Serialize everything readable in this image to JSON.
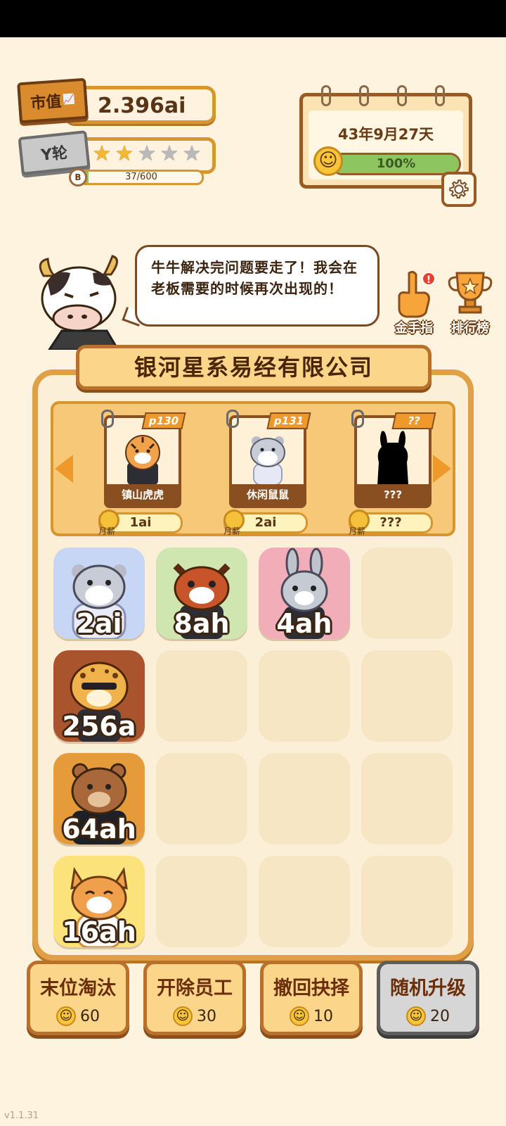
{
  "header": {
    "market_value_label": "市值",
    "market_value": "2.396ai",
    "round_label": "Y轮",
    "stars_filled": 2,
    "stars_total": 5,
    "xp_badge": "B",
    "xp_text": "37/600",
    "xp_current": 37,
    "xp_max": 600
  },
  "calendar": {
    "date": "43年9月27天",
    "mood_text": "100%",
    "mood_percent": 100
  },
  "dialog": {
    "text": "牛牛解决完问题要走了！我会在老板需要的时候再次出现的！"
  },
  "side_buttons": {
    "golden_finger": "金手指",
    "golden_finger_badge": "!",
    "leaderboard": "排行榜"
  },
  "company": {
    "name": "银河星系易经有限公司"
  },
  "candidates": [
    {
      "tag": "p130",
      "name": "镇山虎虎",
      "wage": "1ai",
      "wage_label": "月薪"
    },
    {
      "tag": "p131",
      "name": "休闲鼠鼠",
      "wage": "2ai",
      "wage_label": "月薪"
    },
    {
      "tag": "??",
      "name": "???",
      "wage": "???",
      "wage_label": "月薪"
    }
  ],
  "grid": [
    {
      "animal": "hamster",
      "value": "2ai",
      "bg": "#c8d6f6"
    },
    {
      "animal": "red-panda",
      "value": "8ah",
      "bg": "#cfe6b0"
    },
    {
      "animal": "bunny",
      "value": "4ah",
      "bg": "#f2aeb8"
    },
    {
      "animal": "leopard",
      "value": "256a",
      "bg": "#a9542c"
    },
    {
      "animal": "bear",
      "value": "64ah",
      "bg": "#e59b3a"
    },
    {
      "animal": "cat",
      "value": "16ah",
      "bg": "#fbe27a"
    }
  ],
  "actions": [
    {
      "label": "末位淘汰",
      "cost": "60"
    },
    {
      "label": "开除员工",
      "cost": "30"
    },
    {
      "label": "撤回抉择",
      "cost": "10"
    },
    {
      "label": "随机升级",
      "cost": "20"
    }
  ],
  "version": "v1.1.31",
  "colors": {
    "background": "#fdf3de",
    "accent_orange": "#e0a047",
    "progress_green": "#8dc561",
    "dark_brown": "#5a3417"
  }
}
